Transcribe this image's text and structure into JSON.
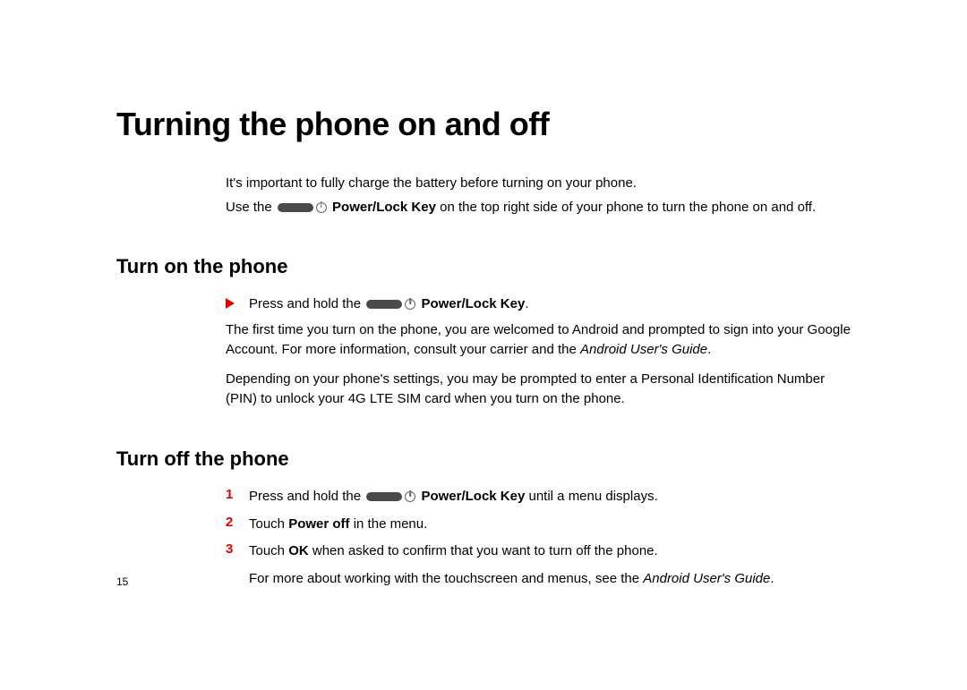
{
  "page": {
    "number": "15",
    "title": "Turning the phone on and off",
    "intro": {
      "p1": "It's important to fully charge the battery before turning on your phone.",
      "p2_prefix": "Use the ",
      "p2_keylabel": " Power/Lock Key",
      "p2_suffix": " on the top right side of your phone to turn the phone on and off."
    },
    "section_on": {
      "heading": "Turn on the phone",
      "step_prefix": "Press and hold the ",
      "step_keylabel": " Power/Lock Key",
      "step_suffix": ".",
      "para1_prefix": "The first time you turn on the phone, you are welcomed to Android and prompted to sign into your Google Account. For more information, consult your carrier and the ",
      "para1_italic": "Android User's Guide",
      "para1_suffix": ".",
      "para2": "Depending on your phone's settings, you may be prompted to enter a Personal Identification Number (PIN) to unlock your 4G LTE SIM card when you turn on the phone."
    },
    "section_off": {
      "heading": "Turn off the phone",
      "steps": {
        "1": {
          "num": "1",
          "prefix": "Press and hold the ",
          "keylabel": " Power/Lock Key",
          "suffix": " until a menu displays."
        },
        "2": {
          "num": "2",
          "prefix": "Touch ",
          "bold": "Power off",
          "suffix": " in the menu."
        },
        "3": {
          "num": "3",
          "prefix": "Touch ",
          "bold": "OK",
          "suffix": " when asked to confirm that you want to turn off the phone."
        }
      },
      "footer_prefix": "For more about working with the touchscreen and menus, see the ",
      "footer_italic": "Android User's Guide",
      "footer_suffix": "."
    }
  }
}
